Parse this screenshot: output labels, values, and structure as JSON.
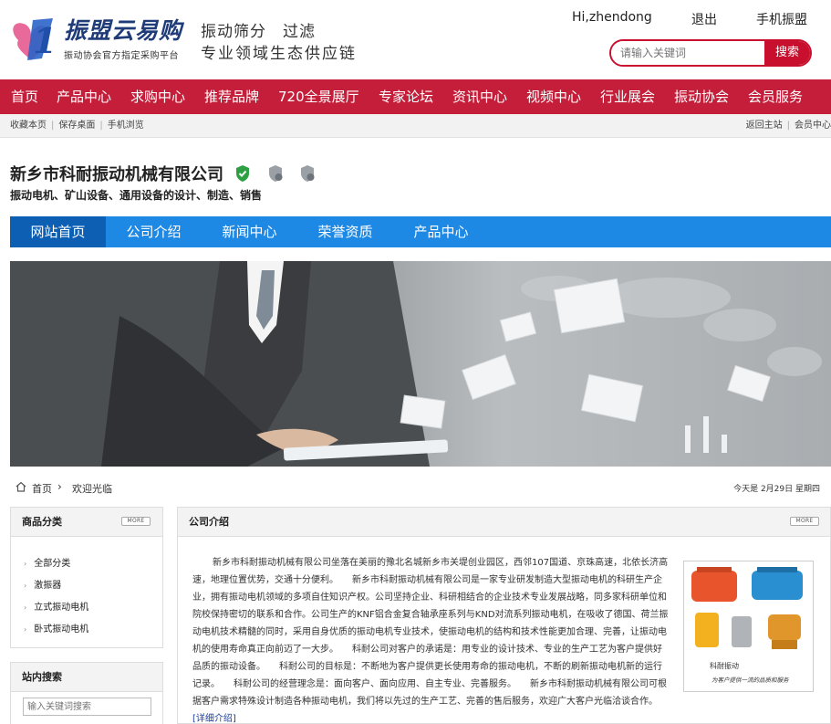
{
  "header": {
    "logo_text": "振盟云易购",
    "logo_sub": "振动协会官方指定采购平台",
    "slogan_line1": "振动筛分　过滤",
    "slogan_line2": "专业领域生态供应链",
    "user_greeting": "Hi,zhendong",
    "logout": "退出",
    "mobile": "手机振盟",
    "search_placeholder": "请输入关键词",
    "search_button": "搜索"
  },
  "nav": {
    "items": [
      "首页",
      "产品中心",
      "求购中心",
      "推荐品牌",
      "720全景展厅",
      "专家论坛",
      "资讯中心",
      "视频中心",
      "行业展会",
      "振动协会",
      "会员服务"
    ]
  },
  "subbar": {
    "left": [
      "收藏本页",
      "保存桌面",
      "手机浏览"
    ],
    "right": [
      "返回主站",
      "会员中心"
    ]
  },
  "company": {
    "name": "新乡市科耐振动机械有限公司",
    "desc": "振动电机、矿山设备、通用设备的设计、制造、销售"
  },
  "company_nav": {
    "items": [
      "网站首页",
      "公司介绍",
      "新闻中心",
      "荣誉资质",
      "产品中心"
    ]
  },
  "breadcrumb": {
    "home": "首页",
    "current": "欢迎光临",
    "date": "今天是 2月29日 星期四"
  },
  "sidebar": {
    "categories_title": "商品分类",
    "more_label": "MORE",
    "categories": [
      "全部分类",
      "激振器",
      "立式振动电机",
      "卧式振动电机"
    ],
    "search_title": "站内搜索",
    "search_placeholder": "输入关键词搜索"
  },
  "intro": {
    "title": "公司介绍",
    "more_label": "MORE",
    "text": "新乡市科耐振动机械有限公司坐落在美丽的豫北名城新乡市关堤创业园区，西邻107国道、京珠高速，北依长济高速，地理位置优势，交通十分便利。　　新乡市科耐振动机械有限公司是一家专业研发制造大型振动电机的科研生产企业，拥有振动电机领域的多项自住知识产权。公司坚持企业、科研相结合的企业技术专业发展战略，同多家科研单位和院校保持密切的联系和合作。公司生产的KNF铝合金复合轴承座系列与KND对流系列振动电机，在吸收了德国、荷兰振动电机技术精髓的同时，采用自身优质的振动电机专业技术，使振动电机的结构和技术性能更加合理、完善，让振动电机的使用寿命真正向前迈了一大步。　　科耐公司对客户的承诺是：用专业的设计技术、专业的生产工艺为客户提供好品质的振动设备。　　科耐公司的目标是：不断地为客户提供更长使用寿命的振动电机，不断的刷新振动电机新的运行记录。　　科耐公司的经营理念是：面向客户、面向应用、自主专业、完善服务。　　新乡市科耐振动机械有限公司可根据客户需求特殊设计制造各种振动电机，我们将以先过的生产工艺、完善的售后服务，欢迎广大客户光临洽谈合作。",
    "detail_link": "[详细介绍]",
    "image_caption_1": "科耐振动",
    "image_caption_2": "为客户提供一流的品质和服务"
  },
  "colors": {
    "brand_red": "#c41e3a",
    "company_blue": "#1e88e5",
    "company_blue_active": "#0d5fb3"
  }
}
